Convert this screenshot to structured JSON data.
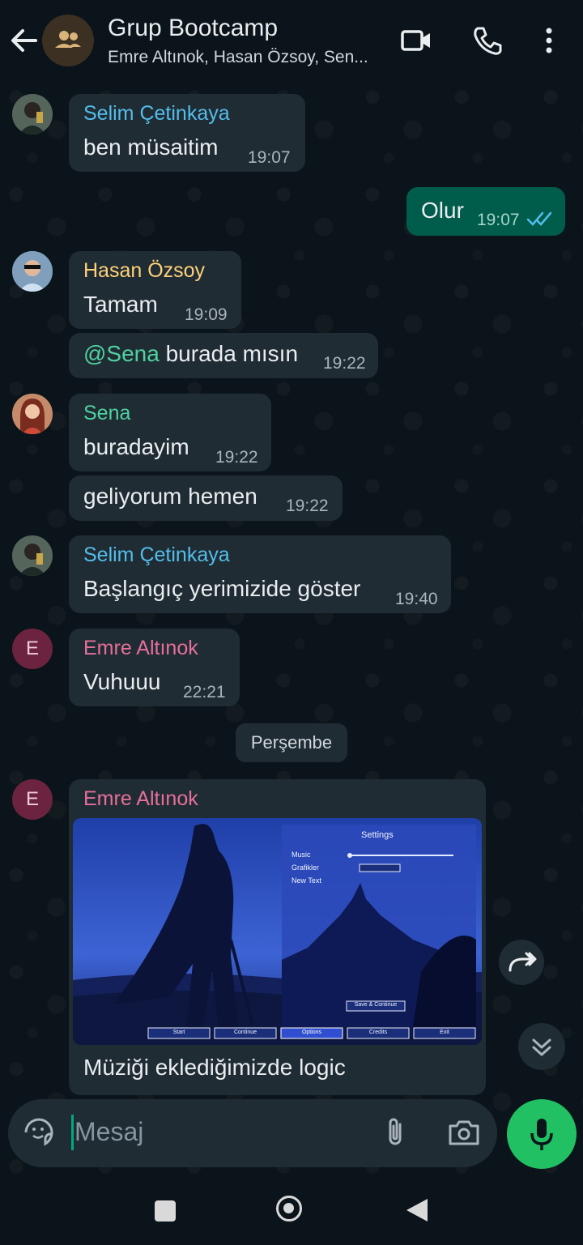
{
  "header": {
    "title": "Grup Bootcamp",
    "subtitle": "Emre Altınok, Hasan Özsoy, Sen..."
  },
  "messages": [
    {
      "sender": "Selim Çetinkaya",
      "sender_color": "#53bdeb",
      "text": "ben müsaitim",
      "time": "19:07"
    },
    {
      "text": "Olur",
      "time": "19:07",
      "outgoing": true,
      "status": "read"
    },
    {
      "sender": "Hasan Özsoy",
      "sender_color": "#ffd279",
      "text": "Tamam",
      "time": "19:09"
    },
    {
      "mention": "@Sena",
      "text": " burada mısın",
      "time": "19:22"
    },
    {
      "sender": "Sena",
      "sender_color": "#4fd1a0",
      "text": "buradayim",
      "time": "19:22"
    },
    {
      "text": "geliyorum hemen",
      "time": "19:22"
    },
    {
      "sender": "Selim Çetinkaya",
      "sender_color": "#53bdeb",
      "text": "Başlangıç yerimizide göster",
      "time": "19:40"
    },
    {
      "sender": "Emre Altınok",
      "sender_color": "#e76f9a",
      "text": "Vuhuuu",
      "time": "22:21"
    },
    {
      "sender": "Emre Altınok",
      "sender_color": "#e76f9a",
      "text": "Müziği eklediğimizde logic"
    }
  ],
  "date_separator": "Perşembe",
  "avatar_letter": "E",
  "game_screenshot": {
    "settings_title": "Settings",
    "settings_rows": [
      "Music",
      "Grafikler",
      "New Text"
    ],
    "save_button": "Save & Continue",
    "menu_buttons": [
      "Start",
      "Continue",
      "Options",
      "Credits",
      "Exit"
    ]
  },
  "composer": {
    "placeholder": "Mesaj"
  },
  "colors": {
    "accent": "#00a884",
    "outgoing_bubble": "#005c4b",
    "incoming_bubble": "#202c33",
    "mic": "#21c063",
    "mention": "#53bdeb"
  },
  "icons": [
    "back-arrow-icon",
    "group-icon",
    "video-call-icon",
    "phone-icon",
    "more-vert-icon",
    "forward-icon",
    "scroll-down-icon",
    "sticker-icon",
    "attach-icon",
    "camera-icon",
    "mic-icon",
    "nav-recent-icon",
    "nav-home-icon",
    "nav-back-icon"
  ]
}
